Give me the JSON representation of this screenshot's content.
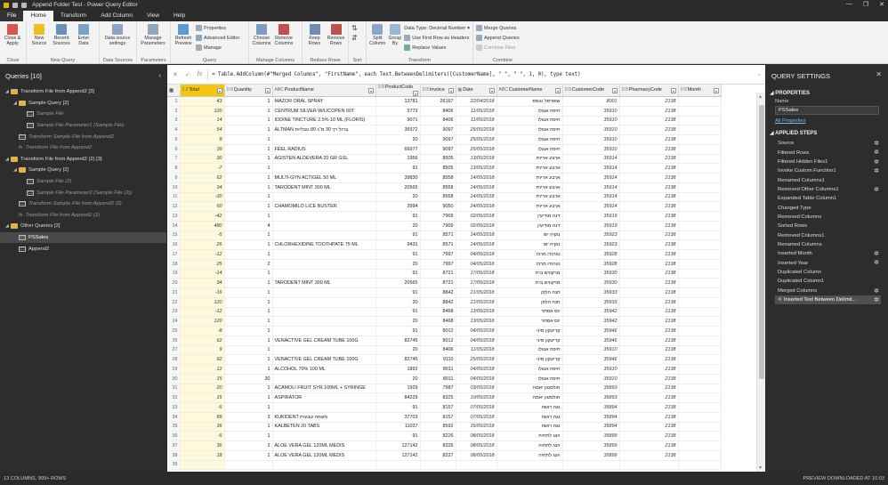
{
  "window": {
    "title": "Append Folder Test - Power Query Editor"
  },
  "tabs": [
    "File",
    "Home",
    "Transform",
    "Add Column",
    "View",
    "Help"
  ],
  "ribbon": {
    "close": {
      "label": "Close & Apply",
      "group": "Close"
    },
    "new_query": {
      "new_source": "New Source",
      "recent_sources": "Recent Sources",
      "enter_data": "Enter Data",
      "group": "New Query"
    },
    "data_sources": {
      "label": "Data source settings",
      "group": "Data Sources"
    },
    "parameters": {
      "label": "Manage Parameters",
      "group": "Parameters"
    },
    "query": {
      "refresh": "Refresh Preview",
      "properties": "Properties",
      "advanced_editor": "Advanced Editor",
      "manage": "Manage",
      "group": "Query"
    },
    "manage_columns": {
      "choose": "Choose Columns",
      "remove": "Remove Columns",
      "group": "Manage Columns"
    },
    "reduce_rows": {
      "keep": "Keep Rows",
      "remove": "Remove Rows",
      "group": "Reduce Rows"
    },
    "sort": {
      "group": "Sort"
    },
    "transform": {
      "split": "Split Column",
      "group_by": "Group By",
      "data_type": "Data Type: Decimal Number",
      "first_row": "Use First Row as Headers",
      "replace": "Replace Values",
      "group": "Transform"
    },
    "combine": {
      "merge": "Merge Queries",
      "append": "Append Queries",
      "combine_files": "Combine Files",
      "group": "Combine"
    }
  },
  "queries": {
    "header": "Queries [10]",
    "items": [
      {
        "label": "Transform File from Append2 [3]",
        "kind": "folder",
        "level": 0
      },
      {
        "label": "Sample Query [2]",
        "kind": "folder",
        "level": 1
      },
      {
        "label": "Sample File",
        "kind": "table",
        "level": 2,
        "muted": true
      },
      {
        "label": "Sample File Parameter1 (Sample File)",
        "kind": "table",
        "level": 2,
        "muted": true
      },
      {
        "label": "Transform Sample File from Append2",
        "kind": "table",
        "level": 1,
        "muted": true
      },
      {
        "label": "Transform File from Append2",
        "kind": "fx",
        "level": 1,
        "muted": true
      },
      {
        "label": "Transform File from Append2 (2) [3]",
        "kind": "folder",
        "level": 0
      },
      {
        "label": "Sample Query [2]",
        "kind": "folder",
        "level": 1
      },
      {
        "label": "Sample File (2)",
        "kind": "table",
        "level": 2,
        "muted": true
      },
      {
        "label": "Sample File Parameter2 (Sample File (2))",
        "kind": "table",
        "level": 2,
        "muted": true
      },
      {
        "label": "Transform Sample File from Append2 (2)",
        "kind": "table",
        "level": 1,
        "muted": true
      },
      {
        "label": "Transform File from Append2 (2)",
        "kind": "fx",
        "level": 1,
        "muted": true
      },
      {
        "label": "Other Queries [2]",
        "kind": "folder",
        "level": 0
      },
      {
        "label": "PSSales",
        "kind": "table",
        "level": 1,
        "selected": true
      },
      {
        "label": "Append2",
        "kind": "table",
        "level": 1
      }
    ]
  },
  "formula": "= Table.AddColumn(#\"Merged Columns\", \"FirstName\", each Text.BetweenDelimiters([CustomerName], \" \", \" \", 1, 0), type text)",
  "grid": {
    "columns": [
      {
        "name": "Total",
        "type": "1.2"
      },
      {
        "name": "Quantity",
        "type": "1²3"
      },
      {
        "name": "ProductName",
        "type": "ABC"
      },
      {
        "name": "ProductCode",
        "type": "1²3"
      },
      {
        "name": "Invoice",
        "type": "1²3"
      },
      {
        "name": "Date",
        "type": "▦"
      },
      {
        "name": "CustomerName",
        "type": "ABC"
      },
      {
        "name": "CustomerCode",
        "type": "1²3"
      },
      {
        "name": "PharmacyCode",
        "type": "1²3"
      },
      {
        "name": "Month",
        "type": "1²3"
      }
    ],
    "rows": [
      [
        "43",
        "1",
        "MAZOR ORAL SPRAY",
        "13781",
        "26167",
        "22/04/2018",
        "שופרסל טופס",
        "8001",
        "2138"
      ],
      [
        "120",
        "1",
        "CENTRUM SILVER W/LICOPEN 60T",
        "5773",
        "8406",
        "11/05/2018",
        "חיפה אנגלו",
        "35910",
        "2138"
      ],
      [
        "14",
        "1",
        "IODINE TINCTURE 2.5% 10 ML (FLORIS)",
        "9071",
        "8406",
        "11/05/2018",
        "חיפה אנגלו",
        "35910",
        "2138"
      ],
      [
        "54",
        "1",
        "ALTMAN          ברזל רך 30 מ\"ג 80 טבליות",
        "36572",
        "9097",
        "25/05/2018",
        "חיפה אנגלו",
        "35910",
        "2138"
      ],
      [
        "8",
        "1",
        "",
        "20",
        "9097",
        "25/05/2018",
        "חיפה אנגלו",
        "35910",
        "2138"
      ],
      [
        "39",
        "1",
        "FEEL RADIUS",
        "66977",
        "9097",
        "25/05/2018",
        "חיפה אנגלו",
        "35910",
        "2138"
      ],
      [
        "30",
        "1",
        "AGISTEN ALDEVERA 20 GR GSL",
        "1956",
        "8505",
        "13/05/2018",
        "ארבע אריות",
        "35914",
        "2138"
      ],
      [
        "-7",
        "1",
        "",
        "91",
        "8505",
        "13/05/2018",
        "ארבע אריות",
        "35914",
        "2138"
      ],
      [
        "62",
        "1",
        "MULTI-GYN ACTIGEL 50 ML",
        "39830",
        "8558",
        "14/05/2018",
        "ארבע אריות",
        "35914",
        "2138"
      ],
      [
        "34",
        "1",
        "TARODENT MINT 300 ML",
        "20565",
        "8558",
        "14/05/2018",
        "ארבע אריות",
        "35914",
        "2138"
      ],
      [
        "-30",
        "1",
        "",
        "20",
        "8558",
        "14/05/2018",
        "ארבע אריות",
        "35914",
        "2138"
      ],
      [
        "60",
        "1",
        "CHAMOMILO LICE  BUSTER",
        "3994",
        "9050",
        "24/05/2018",
        "ארבע אריות",
        "35914",
        "2138"
      ],
      [
        "-42",
        "1",
        "",
        "91",
        "7909",
        "02/05/2018",
        "דנה מודיעין",
        "35919",
        "2138"
      ],
      [
        "480",
        "4",
        "",
        "20",
        "7909",
        "02/05/2018",
        "דנה מודיעין",
        "35919",
        "2138"
      ],
      [
        "-5",
        "1",
        "",
        "91",
        "8571",
        "14/05/2018",
        "נוקיה יפו",
        "35923",
        "2138"
      ],
      [
        "26",
        "1",
        "CHLORHEXIDINE TOOTHPATE 75 ML",
        "9431",
        "8571",
        "14/05/2018",
        "נוקיה יפו",
        "35923",
        "2138"
      ],
      [
        "-12",
        "1",
        "",
        "91",
        "7997",
        "04/05/2018",
        "טורנדו מרכז",
        "35928",
        "2138"
      ],
      [
        "25",
        "2",
        "",
        "20",
        "7997",
        "04/05/2018",
        "טורנדו מרכז",
        "35928",
        "2138"
      ],
      [
        "-14",
        "1",
        "",
        "91",
        "8721",
        "17/05/2018",
        "מרקוויש בית",
        "35930",
        "2138"
      ],
      [
        "34",
        "1",
        "TARODENT MINT 300 ML",
        "20565",
        "8721",
        "17/05/2018",
        "מרקוויש בית",
        "35930",
        "2138"
      ],
      [
        "-16",
        "1",
        "",
        "91",
        "8842",
        "21/05/2018",
        "חנה הלפן",
        "35933",
        "2138"
      ],
      [
        "120",
        "1",
        "",
        "20",
        "8842",
        "21/05/2018",
        "חנה הלפן",
        "35933",
        "2138"
      ],
      [
        "-12",
        "1",
        "",
        "91",
        "8468",
        "13/05/2018",
        "יוס אסתר",
        "35942",
        "2138"
      ],
      [
        "120",
        "1",
        "",
        "20",
        "8468",
        "13/05/2018",
        "יוס אסתר",
        "35942",
        "2138"
      ],
      [
        "-8",
        "1",
        "",
        "91",
        "8012",
        "04/05/2018",
        "קריעקון סיני",
        "35946",
        "2138"
      ],
      [
        "62",
        "1",
        "VENACTIVE GEL CREAM TUBE 100G",
        "82745",
        "8012",
        "04/05/2018",
        "קריעקון סיני",
        "35946",
        "2138"
      ],
      [
        "9",
        "1",
        "",
        "20",
        "8406",
        "11/05/2018",
        "חיפה אנגלו",
        "35910",
        "2138"
      ],
      [
        "62",
        "1",
        "VENACTIVE GEL CREAM TUBE 100G",
        "82745",
        "9110",
        "25/05/2018",
        "קריעקון סיני",
        "35946",
        "2138"
      ],
      [
        "12",
        "1",
        "ALCOHOL 70% 100 ML",
        "1892",
        "8011",
        "04/05/2018",
        "חיפה אנגלו",
        "35910",
        "2138"
      ],
      [
        "15",
        "30",
        "",
        "20",
        "8011",
        "04/05/2018",
        "חיפה אנגלו",
        "35910",
        "2138"
      ],
      [
        "20",
        "1",
        "ACAMOLI FRUIT SYR.100ML + SYRINGE",
        "1929",
        "7987",
        "03/05/2018",
        "חולסטון יאמה",
        "35893",
        "2138"
      ],
      [
        "15",
        "1",
        "ASPIRATOR",
        "84229",
        "8325",
        "10/05/2018",
        "חולסטון יאמה",
        "35893",
        "2138"
      ],
      [
        "-5",
        "1",
        "",
        "91",
        "8157",
        "07/05/2018",
        "נגה רושה",
        "35894",
        "2138"
      ],
      [
        "89",
        "3",
        "KUKIDENT           משחה טבעית",
        "37703",
        "8157",
        "07/05/2018",
        "נגה רושה",
        "35894",
        "2138"
      ],
      [
        "36",
        "1",
        "KALBETEN 20 TABS",
        "11037",
        "8592",
        "15/05/2018",
        "נגה רושה",
        "35894",
        "2138"
      ],
      [
        "-5",
        "1",
        "",
        "91",
        "8226",
        "08/05/2018",
        "ויצג לתחיה",
        "35899",
        "2138"
      ],
      [
        "36",
        "2",
        "ALOE VERA GEL 120ML MEDIS",
        "127142",
        "8226",
        "08/05/2018",
        "ויצג לתחיה",
        "35899",
        "2138"
      ],
      [
        "18",
        "1",
        "ALOE VERA GEL 120ML MEDIS",
        "127142",
        "8227",
        "08/05/2018",
        "ויצג לתחיה",
        "35899",
        "2138"
      ],
      [
        "",
        "",
        "",
        "",
        "",
        "",
        "",
        "",
        ""
      ]
    ]
  },
  "settings": {
    "header": "QUERY SETTINGS",
    "properties": "PROPERTIES",
    "name_label": "Name",
    "name_value": "PSSales",
    "all_properties": "All Properties",
    "applied_steps": "APPLIED STEPS",
    "steps": [
      {
        "label": "Source",
        "gear": true
      },
      {
        "label": "Filtered Rows",
        "gear": true
      },
      {
        "label": "Filtered Hidden Files1",
        "gear": true
      },
      {
        "label": "Invoke Custom Function1",
        "gear": true
      },
      {
        "label": "Renamed Columns1",
        "gear": false
      },
      {
        "label": "Removed Other Columns1",
        "gear": true
      },
      {
        "label": "Expanded Table Column1",
        "gear": false
      },
      {
        "label": "Changed Type",
        "gear": false
      },
      {
        "label": "Removed Columns",
        "gear": false
      },
      {
        "label": "Sorted Rows",
        "gear": false
      },
      {
        "label": "Removed Columns1",
        "gear": false
      },
      {
        "label": "Renamed Columns",
        "gear": false
      },
      {
        "label": "Inserted Month",
        "gear": true
      },
      {
        "label": "Inserted Year",
        "gear": true
      },
      {
        "label": "Duplicated Column",
        "gear": false
      },
      {
        "label": "Duplicated Column1",
        "gear": false
      },
      {
        "label": "Merged Columns",
        "gear": true
      },
      {
        "label": "Inserted Text Between Delimit...",
        "gear": true,
        "current": true
      }
    ]
  },
  "status": {
    "left": "13 COLUMNS, 999+ ROWS",
    "right": "PREVIEW DOWNLOADED AT 10:03"
  }
}
